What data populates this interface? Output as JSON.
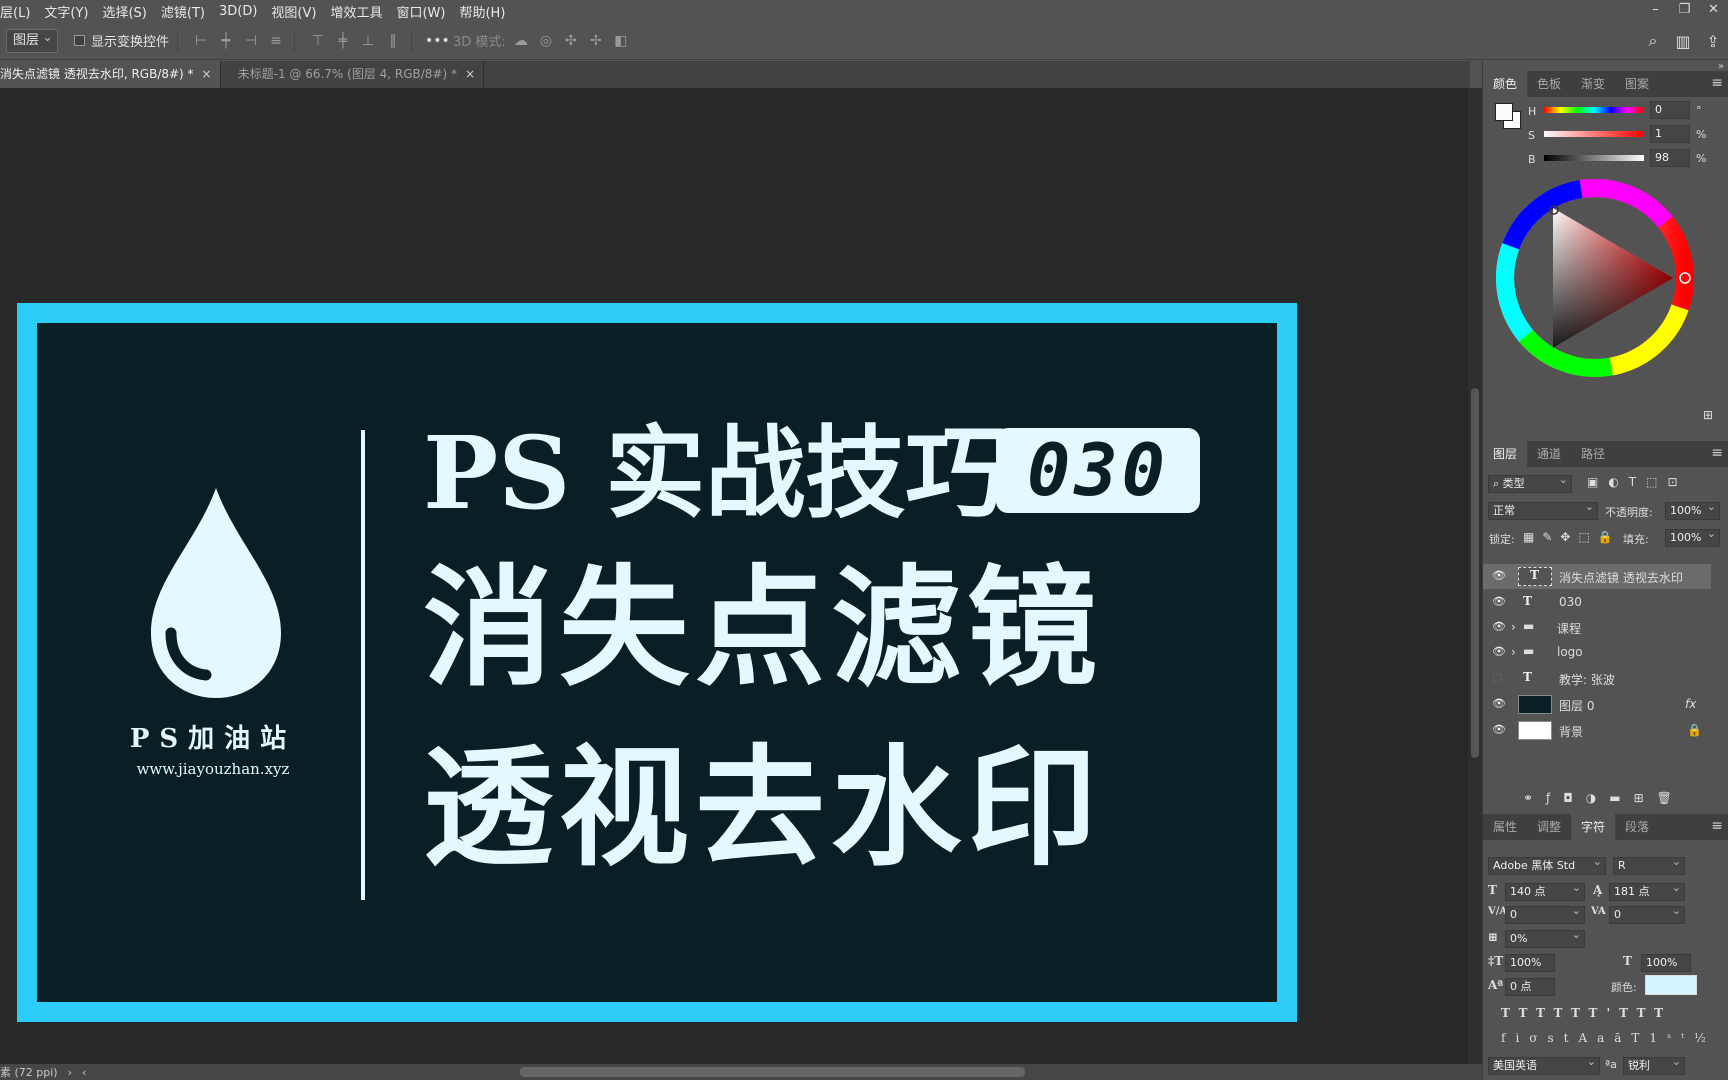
{
  "menu": [
    "层(L)",
    "文字(Y)",
    "选择(S)",
    "滤镜(T)",
    "3D(D)",
    "视图(V)",
    "增效工具",
    "窗口(W)",
    "帮助(H)"
  ],
  "options": {
    "tool_select": "图层",
    "show_transform": "显示变换控件",
    "mode_3d": "3D 模式:"
  },
  "tabs": [
    {
      "label": "消失点滤镜 透视去水印, RGB/8#) *",
      "active": true
    },
    {
      "label": "未标题-1 @ 66.7% (图层 4, RGB/8#) *",
      "active": false
    }
  ],
  "canvas": {
    "brand": "PS加油站",
    "url": "www.jiayouzhan.xyz",
    "title_line1": "PS 实战技巧",
    "badge": "030",
    "title_line2": "消失点滤镜",
    "title_line3": "透视去水印",
    "colors": {
      "frame": "#2bcdf7",
      "bg": "#0a1e25",
      "text": "#e3f8ff"
    }
  },
  "status": {
    "text": "素 (72 ppi)"
  },
  "color_panel": {
    "tabs": [
      "颜色",
      "色板",
      "渐变",
      "图案"
    ],
    "h_label": "H",
    "h_value": "0",
    "h_unit": "°",
    "s_label": "S",
    "s_value": "1",
    "s_unit": "%",
    "b_label": "B",
    "b_value": "98",
    "b_unit": "%"
  },
  "layers_panel": {
    "tabs": [
      "图层",
      "通道",
      "路径"
    ],
    "filter": "类型",
    "blend": "正常",
    "opacity_label": "不透明度:",
    "opacity": "100%",
    "lock_label": "锁定:",
    "fill_label": "填充:",
    "fill": "100%",
    "layers": [
      {
        "type": "T",
        "name": "消失点滤镜 透视去水印",
        "visible": true,
        "selected": true
      },
      {
        "type": "T",
        "name": "030",
        "visible": true
      },
      {
        "type": "folder",
        "name": "课程",
        "visible": true
      },
      {
        "type": "folder",
        "name": "logo",
        "visible": true
      },
      {
        "type": "T",
        "name": "教学: 张波",
        "visible": false
      },
      {
        "type": "image",
        "name": "图层 0",
        "visible": true,
        "fx": "fx"
      },
      {
        "type": "image",
        "name": "背景",
        "visible": true
      }
    ]
  },
  "char_panel": {
    "tabs": [
      "属性",
      "调整",
      "字符",
      "段落"
    ],
    "font_family": "Adobe 黑体 Std",
    "font_style": "R",
    "size": "140 点",
    "leading": "181 点",
    "kerning": "0",
    "tracking": "0",
    "scale_pct": "0%",
    "vscale": "100%",
    "hscale": "100%",
    "baseline": "0 点",
    "color_label": "颜色:",
    "text_color": "#d4f4ff",
    "language": "美国英语",
    "aa_label": "ªa",
    "antialias": "锐利"
  }
}
